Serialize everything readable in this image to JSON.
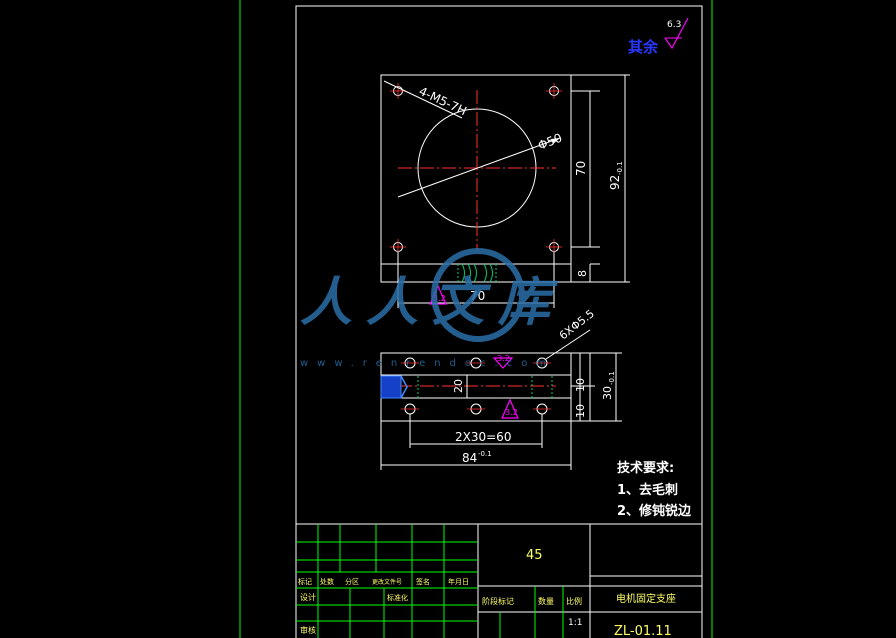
{
  "roughness": {
    "label": "其余",
    "value": "6.3"
  },
  "top_view": {
    "hole_callout": "4-M5-7H",
    "circle_dia": "Φ50",
    "dim_height_inner": "70",
    "dim_height_total": "92",
    "dim_height_total_tol": "-0.1",
    "dim_width_inner": "70",
    "dim_bottom": "8",
    "surface_finish": "3.2"
  },
  "side_view": {
    "hole_callout": "6XΦ5.5",
    "dim_spacing": "2X30=60",
    "dim_width_total": "84",
    "dim_width_tol": "-0.1",
    "dim_inner_height": "20",
    "dim_left_a": "10",
    "dim_left_b": "10",
    "dim_height_total": "30",
    "dim_height_tol": "-0.1",
    "finish_top": "3.2",
    "finish_bottom": "3.2"
  },
  "tech_requirements": {
    "title": "技术要求:",
    "items": [
      "1、去毛刺",
      "2、修钝锐边"
    ]
  },
  "title_block": {
    "material": "45",
    "part_name": "电机固定支座",
    "drawing_no": "ZL-01.11",
    "scale": "1:1",
    "headers": [
      "标记",
      "处数",
      "分区",
      "更改文件号",
      "签名",
      "年月日"
    ],
    "row_design": "设计",
    "row_standard": "标准化",
    "row_audit": "审核",
    "stage_labels": [
      "阶段标记",
      "数量",
      "比例"
    ]
  },
  "watermark": {
    "logo_text": "人人文库",
    "url_text": "www.renrendoc.com"
  },
  "colors": {
    "outline": "#ffffff",
    "center_line": "#ff3030",
    "dimension": "#ffffff",
    "hidden_line": "#00cc66",
    "table_grid": "#00ff00",
    "magenta": "#ff00ff",
    "label_yellow": "#ffff66",
    "roughness_blue": "#2a38ff",
    "watermark": "#2a6fa8"
  }
}
